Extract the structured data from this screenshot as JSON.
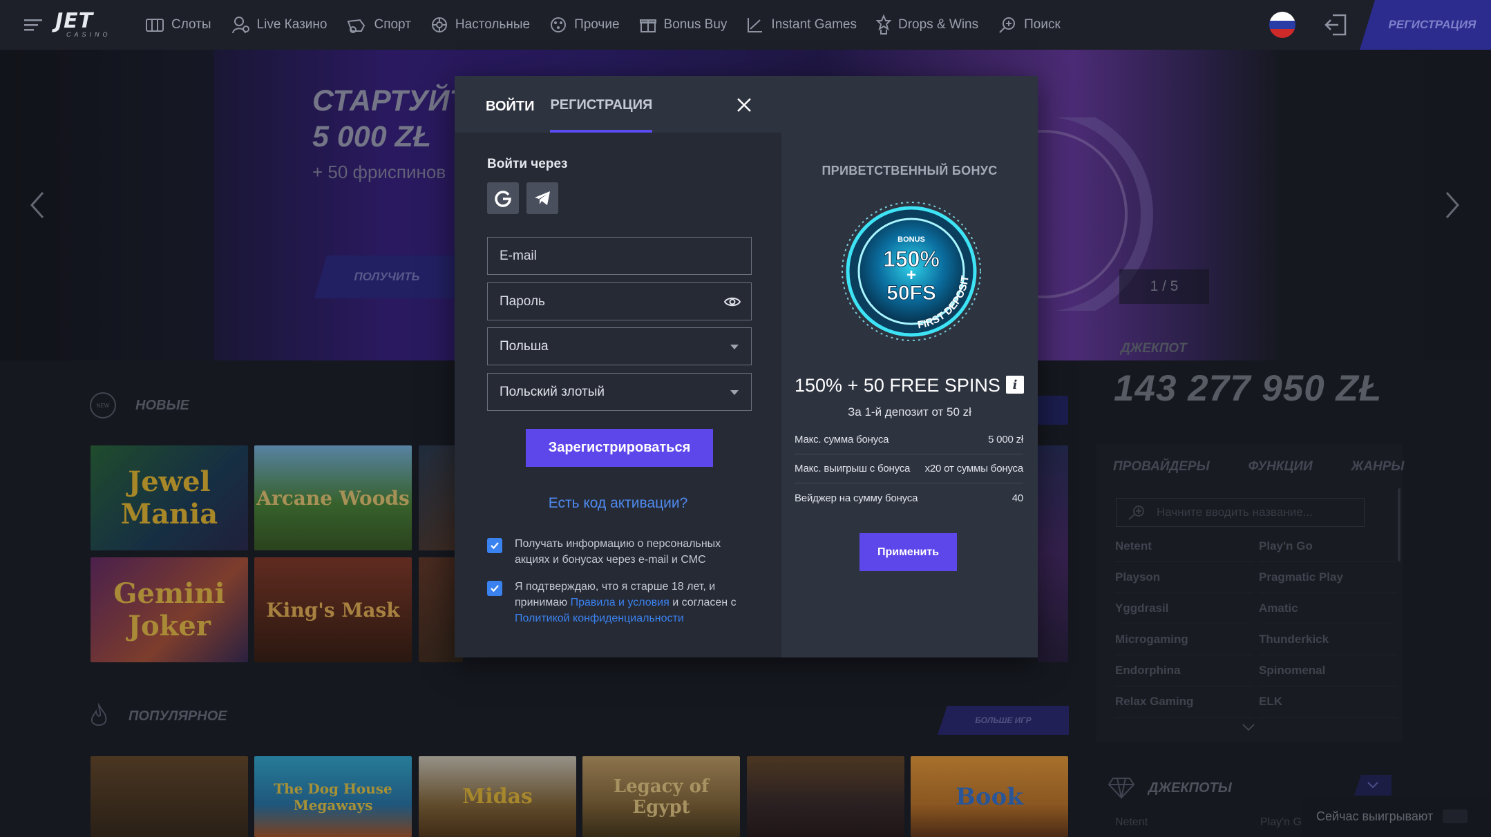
{
  "header": {
    "logo": {
      "main": "JET",
      "sub": "CASINO"
    },
    "nav": [
      {
        "label": "Слоты",
        "icon": "slots-icon"
      },
      {
        "label": "Live Казино",
        "icon": "live-casino-icon"
      },
      {
        "label": "Спорт",
        "icon": "sport-icon"
      },
      {
        "label": "Настольные",
        "icon": "table-games-icon"
      },
      {
        "label": "Прочие",
        "icon": "other-games-icon"
      },
      {
        "label": "Bonus Buy",
        "icon": "bonus-buy-icon"
      },
      {
        "label": "Instant Games",
        "icon": "instant-games-icon"
      },
      {
        "label": "Drops & Wins",
        "icon": "drops-wins-icon"
      },
      {
        "label": "Поиск",
        "icon": "search-icon"
      }
    ],
    "register_label": "РЕГИСТРАЦИЯ"
  },
  "banner": {
    "line1": "СТАРТУЙТ",
    "line2": "5 000 ZŁ",
    "line3": "+ 50 фриспинов",
    "cta": "ПОЛУЧИТЬ",
    "slide_indicator": "1 / 5"
  },
  "jackpot": {
    "label": "ДЖЕКПОТ",
    "value": "143 277 950 ZŁ"
  },
  "sections": {
    "new": {
      "title": "НОВЫЕ",
      "badge": "NEW"
    },
    "popular": {
      "title": "ПОПУЛЯРНОЕ",
      "more": "БОЛЬШЕ ИГР"
    },
    "jackpots": {
      "title": "ДЖЕКПОТЫ"
    }
  },
  "games_new": [
    {
      "title": "Jewel Mania"
    },
    {
      "title": "Arcane Woods"
    },
    {
      "title": "Gemini Joker"
    },
    {
      "title": "King's Mask"
    }
  ],
  "games_popular": [
    {
      "title": ""
    },
    {
      "title": "The Dog House Megaways"
    },
    {
      "title": "Midas"
    },
    {
      "title": "Legacy of Egypt"
    },
    {
      "title": ""
    },
    {
      "title": "Book"
    }
  ],
  "filters": {
    "tabs": [
      "ПРОВАЙДЕРЫ",
      "ФУНКЦИИ",
      "ЖАНРЫ"
    ],
    "search_placeholder": "Начните вводить название...",
    "providers_left": [
      "Netent",
      "Playson",
      "Yggdrasil",
      "Microgaming",
      "Endorphina",
      "Relax Gaming"
    ],
    "providers_right": [
      "Play'n Go",
      "Pragmatic Play",
      "Amatic",
      "Thunderkick",
      "Spinomenal",
      "ELK"
    ],
    "bottom_left": "Netent",
    "bottom_right": "Play'n G"
  },
  "now_winning": {
    "label": "Сейчас выигрывают"
  },
  "modal": {
    "tabs": {
      "login": "ВОЙТИ",
      "register": "РЕГИСТРАЦИЯ"
    },
    "login_via": "Войти через",
    "email_placeholder": "E-mail",
    "password_placeholder": "Пароль",
    "country": "Польша",
    "currency": "Польский злотый",
    "submit": "Зарегистрироваться",
    "activation_link": "Есть код активации?",
    "consent_1": "Получать информацию о персональных акциях и бонусах через e-mail и СМС",
    "consent_2_part1": "Я подтверждаю, что я старше 18 лет, и принимаю ",
    "consent_2_link1": "Правила и условия",
    "consent_2_part2": " и согласен с ",
    "consent_2_link2": "Политикой конфиденциальности"
  },
  "bonus": {
    "title": "ПРИВЕТСТВЕННЫЙ БОНУС",
    "coin": {
      "top": "BONUS",
      "pct": "150%",
      "plus": "+",
      "fs": "50FS",
      "ring": "FIRST DEPOSIT"
    },
    "name": "150% + 50 FREE SPINS",
    "subtitle": "За 1-й депозит от 50 zł",
    "rows": [
      {
        "label": "Макс. сумма бонуса",
        "value": "5 000 zł"
      },
      {
        "label": "Макс. выигрыш с бонуса",
        "value": "x20 от суммы бонуса"
      },
      {
        "label": "Вейджер на сумму бонуса",
        "value": "40"
      }
    ],
    "apply": "Применить"
  },
  "colors": {
    "accent": "#5d47ea",
    "link": "#3a82ef",
    "background": "#1b1e27"
  }
}
